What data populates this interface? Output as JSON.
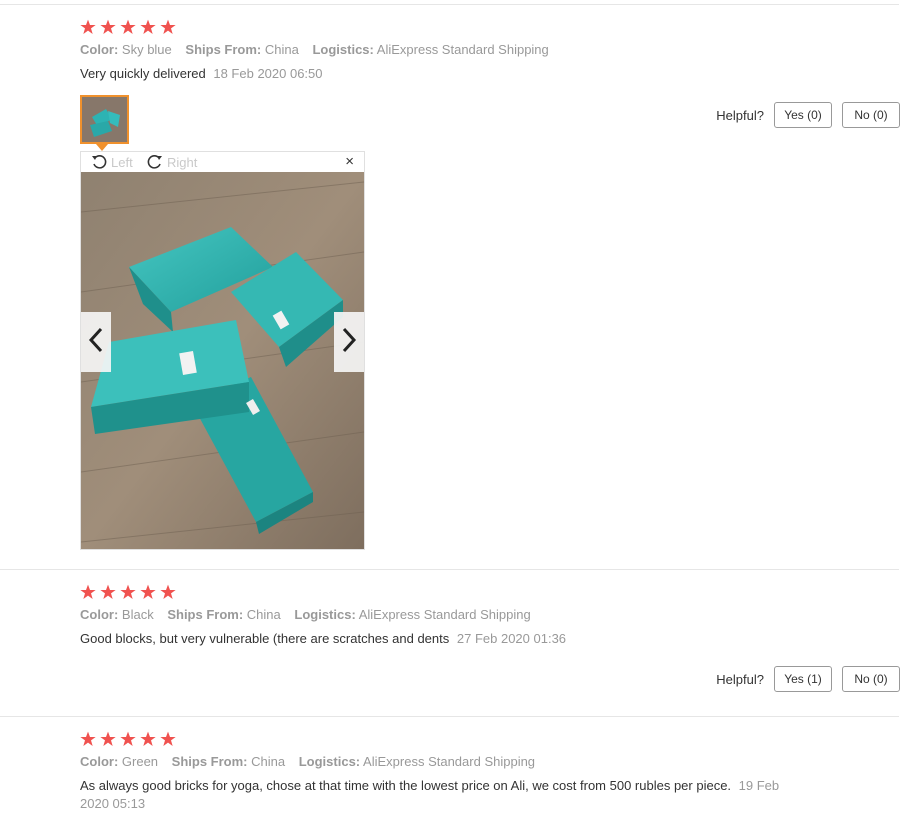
{
  "colors": {
    "star": "#f0524f",
    "accent": "#f0912d",
    "muted": "#999999",
    "text": "#333333",
    "divider": "#e6e6e6"
  },
  "labels": {
    "color": "Color:",
    "ships_from": "Ships From:",
    "logistics": "Logistics:",
    "helpful": "Helpful?"
  },
  "reviews": [
    {
      "stars": 5,
      "color": "Sky blue",
      "ships_from": "China",
      "logistics": "AliExpress Standard Shipping",
      "text": "Very quickly delivered",
      "date": "18 Feb 2020 06:50",
      "yes": "Yes (0)",
      "no": "No (0)"
    },
    {
      "stars": 5,
      "color": "Black",
      "ships_from": "China",
      "logistics": "AliExpress Standard Shipping",
      "text": "Good blocks, but very vulnerable (there are scratches and dents",
      "date": "27 Feb 2020 01:36",
      "yes": "Yes (1)",
      "no": "No (0)"
    },
    {
      "stars": 5,
      "color": "Green",
      "ships_from": "China",
      "logistics": "AliExpress Standard Shipping",
      "text": "As always good bricks for yoga, chose at that time with the lowest price on Ali, we cost from 500 rubles per piece.",
      "date": "19 Feb 2020 05:13"
    }
  ],
  "viewer": {
    "rotate_left": "Left",
    "rotate_right": "Right",
    "close": "×",
    "icons": [
      "rotate-left-icon",
      "rotate-right-icon",
      "close-icon",
      "chevron-left-icon",
      "chevron-right-icon"
    ]
  }
}
